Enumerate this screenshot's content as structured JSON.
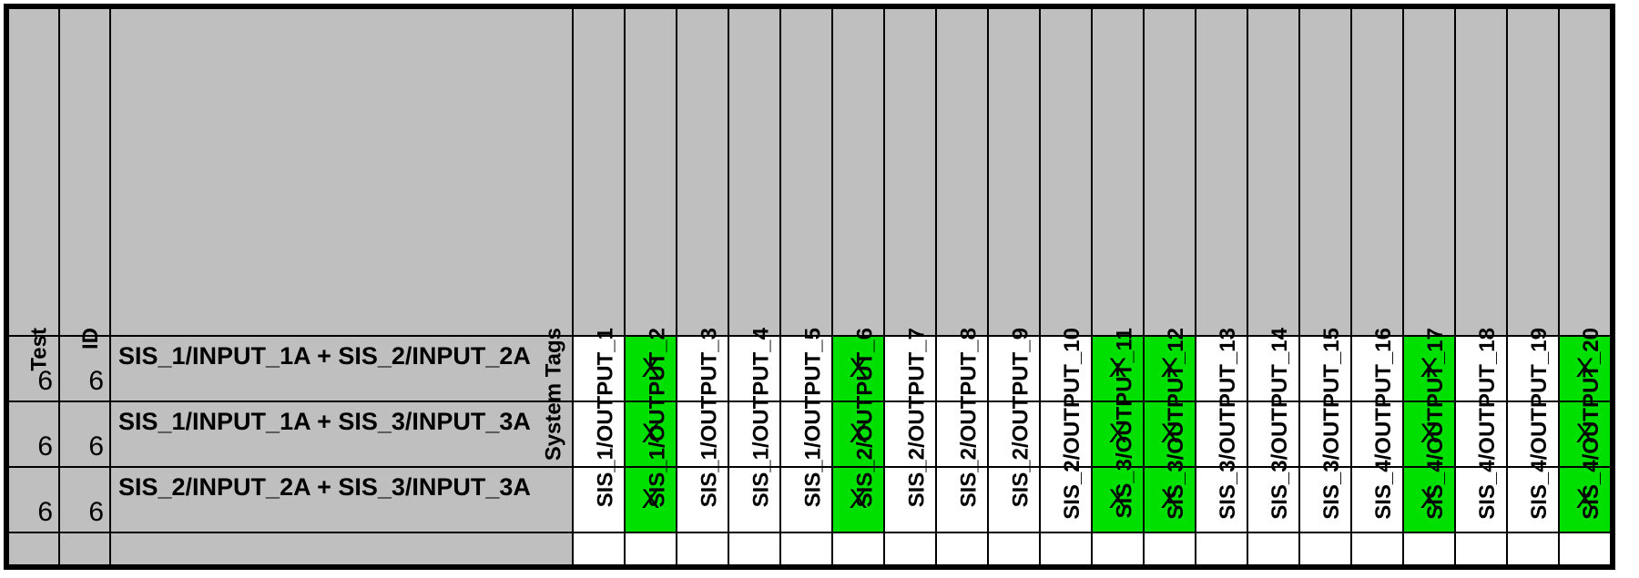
{
  "headers": {
    "test": "Test",
    "id": "ID",
    "tags": "System Tags"
  },
  "output_columns": [
    "SIS_1/OUTPUT_1",
    "SIS_1/OUTPUT_2",
    "SIS_1/OUTPUT_3",
    "SIS_1/OUTPUT_4",
    "SIS_1/OUTPUT_5",
    "SIS_2/OUTPUT_6",
    "SIS_2/OUTPUT_7",
    "SIS_2/OUTPUT_8",
    "SIS_2/OUTPUT_9",
    "SIS_2/OUTPUT_10",
    "SIS_3/OUTPUT_11",
    "SIS_3/OUTPUT_12",
    "SIS_3/OUTPUT_13",
    "SIS_3/OUTPUT_14",
    "SIS_3/OUTPUT_15",
    "SIS_4/OUTPUT_16",
    "SIS_4/OUTPUT_17",
    "SIS_4/OUTPUT_18",
    "SIS_4/OUTPUT_19",
    "SIS_4/OUTPUT_20"
  ],
  "rows": [
    {
      "test": "6",
      "id": "6",
      "tags": "SIS_1/INPUT_1A + SIS_2/INPUT_2A",
      "outputs": [
        "",
        "X",
        "",
        "",
        "",
        "X",
        "",
        "",
        "",
        "",
        "X",
        "X",
        "",
        "",
        "",
        "",
        "X",
        "",
        "",
        "X"
      ]
    },
    {
      "test": "6",
      "id": "6",
      "tags": "SIS_1/INPUT_1A + SIS_3/INPUT_3A",
      "outputs": [
        "",
        "X",
        "",
        "",
        "",
        "X",
        "",
        "",
        "",
        "",
        "X",
        "X",
        "",
        "",
        "",
        "",
        "X",
        "",
        "",
        "X"
      ]
    },
    {
      "test": "6",
      "id": "6",
      "tags": "SIS_2/INPUT_2A + SIS_3/INPUT_3A",
      "outputs": [
        "",
        "X",
        "",
        "",
        "",
        "X",
        "",
        "",
        "",
        "",
        "X",
        "X",
        "",
        "",
        "",
        "",
        "X",
        "",
        "",
        "X"
      ]
    }
  ],
  "marker": "X",
  "colors": {
    "header_bg": "#bfbfbf",
    "hit_bg": "#00e000"
  }
}
